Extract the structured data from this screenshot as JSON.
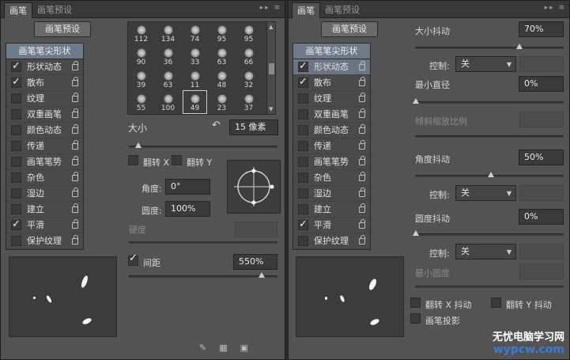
{
  "tabs": [
    "画笔",
    "画笔预设"
  ],
  "brush_preset_button": "画笔预设",
  "list_header": "画笔笔尖形状",
  "list_items": [
    {
      "label": "形状动态",
      "checked": true
    },
    {
      "label": "散布",
      "checked": true
    },
    {
      "label": "纹理",
      "checked": false
    },
    {
      "label": "双重画笔",
      "checked": false
    },
    {
      "label": "颜色动态",
      "checked": false
    },
    {
      "label": "传递",
      "checked": false
    },
    {
      "label": "画笔笔势",
      "checked": false
    },
    {
      "label": "杂色",
      "checked": false
    },
    {
      "label": "湿边",
      "checked": false
    },
    {
      "label": "建立",
      "checked": false
    },
    {
      "label": "平滑",
      "checked": true
    },
    {
      "label": "保护纹理",
      "checked": false
    }
  ],
  "brush_sizes": [
    "112",
    "134",
    "74",
    "95",
    "95",
    "90",
    "36",
    "33",
    "63",
    "66",
    "39",
    "63",
    "11",
    "48",
    "32",
    "55",
    "100",
    "49",
    "23",
    "37"
  ],
  "left": {
    "size_label": "大小",
    "size_value": "15 像素",
    "flip_x": "翻转 X",
    "flip_y": "翻转 Y",
    "angle_label": "角度:",
    "angle_value": "0°",
    "roundness_label": "圆度:",
    "roundness_value": "100%",
    "hardness_label": "硬度",
    "spacing_label": "间距",
    "spacing_value": "550%"
  },
  "right": {
    "size_jitter_label": "大小抖动",
    "size_jitter_value": "70%",
    "control_label": "控制:",
    "control_off": "关",
    "min_diameter_label": "最小直径",
    "min_diameter_value": "0%",
    "tilt_scale_label": "倾斜缩放比例",
    "angle_jitter_label": "角度抖动",
    "angle_jitter_value": "50%",
    "roundness_jitter_label": "圆度抖动",
    "roundness_jitter_value": "0%",
    "min_roundness_label": "最小圆度",
    "flip_x_jitter": "翻转 X 抖动",
    "flip_y_jitter": "翻转 Y 抖动",
    "brush_projection": "画笔投影"
  },
  "watermark": {
    "line1": "无忧电脑学习网",
    "line2": "wypcw.com"
  }
}
